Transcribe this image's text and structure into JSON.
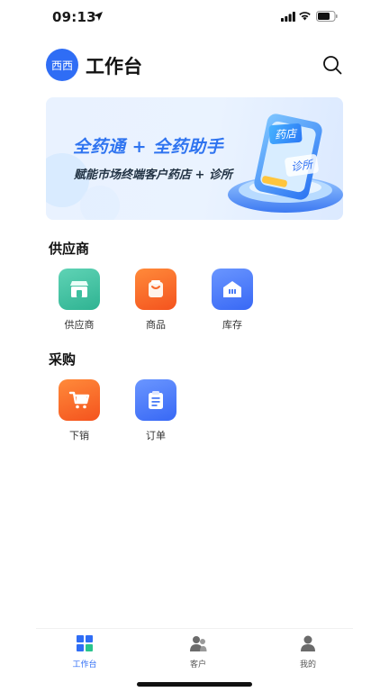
{
  "status_bar": {
    "time": "09:13"
  },
  "header": {
    "avatar_text": "西西",
    "title": "工作台"
  },
  "banner": {
    "headline": "全药通 + 全药助手",
    "subline": "赋能市场终端客户药店 + 诊所",
    "tag_pharmacy": "药店",
    "tag_clinic": "诊所"
  },
  "sections": [
    {
      "title": "供应商",
      "items": [
        {
          "label": "供应商",
          "icon": "storefront-icon",
          "color": "#3cc09f"
        },
        {
          "label": "商品",
          "icon": "product-bag-icon",
          "color": "#f7682a"
        },
        {
          "label": "库存",
          "icon": "warehouse-icon",
          "color": "#4a7cf7"
        }
      ]
    },
    {
      "title": "采购",
      "items": [
        {
          "label": "下销",
          "icon": "shopping-cart-icon",
          "color": "#f7682a"
        },
        {
          "label": "订单",
          "icon": "clipboard-icon",
          "color": "#4a7cf7"
        }
      ]
    }
  ],
  "tabbar": {
    "active": "工作台",
    "items": [
      {
        "label": "工作台",
        "icon": "workbench-icon"
      },
      {
        "label": "客户",
        "icon": "customers-icon"
      },
      {
        "label": "我的",
        "icon": "profile-icon"
      }
    ],
    "active_color": "#2f6df5"
  }
}
